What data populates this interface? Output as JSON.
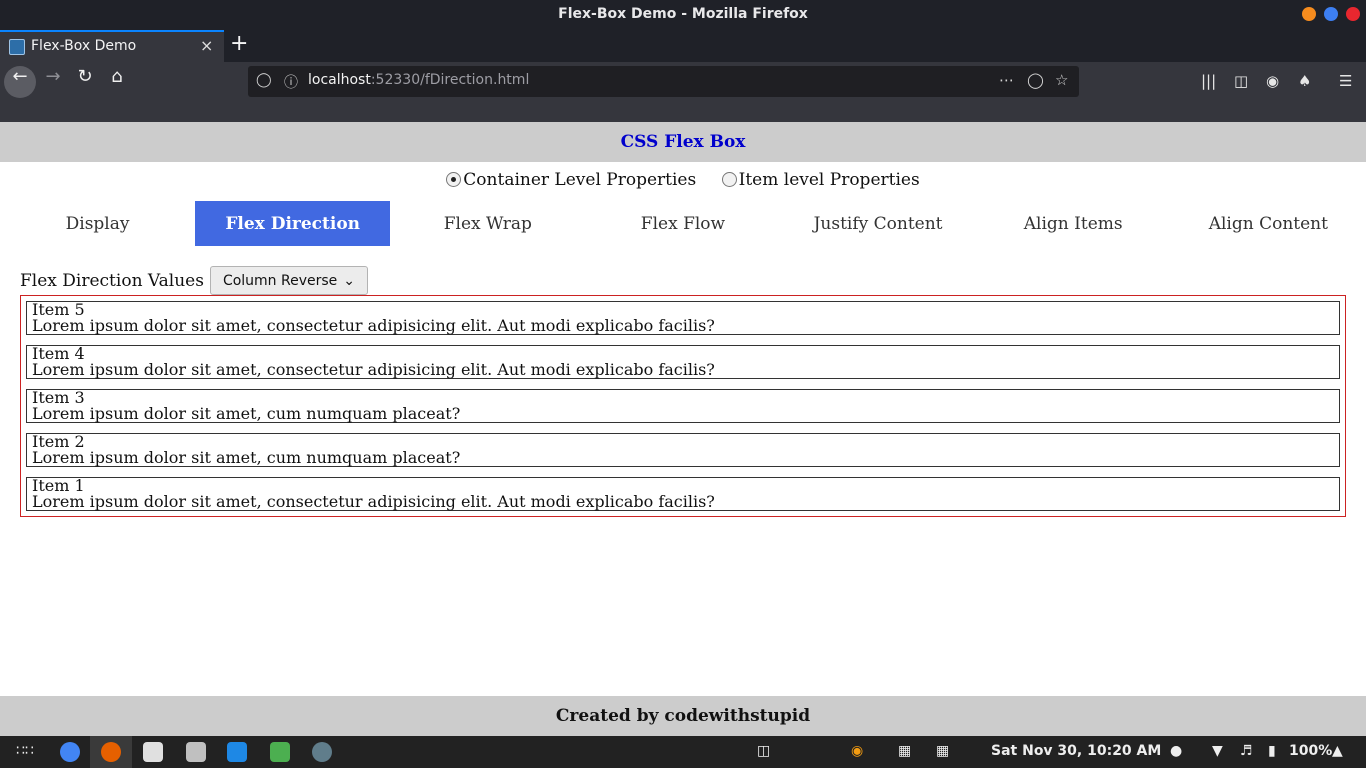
{
  "window": {
    "title": "Flex-Box Demo - Mozilla Firefox"
  },
  "browser": {
    "tab_title": "Flex-Box Demo",
    "tab_close": "×",
    "new_tab": "+",
    "url_host": "localhost",
    "url_rest": ":52330/fDirection.html",
    "icons": [
      "back-icon",
      "forward-icon",
      "reload-icon",
      "home-icon",
      "shield-icon",
      "info-icon",
      "more-icon",
      "pocket-icon",
      "bookmark-star-icon",
      "library-icon",
      "sidebar-icon",
      "account-icon",
      "extension-icon",
      "menu-icon"
    ]
  },
  "page": {
    "header_title": "CSS Flex Box",
    "radios": [
      {
        "label": "Container Level Properties",
        "checked": true
      },
      {
        "label": "Item level Properties",
        "checked": false
      }
    ],
    "tabs": [
      {
        "label": "Display"
      },
      {
        "label": "Flex Direction"
      },
      {
        "label": "Flex Wrap"
      },
      {
        "label": "Flex Flow"
      },
      {
        "label": "Justify Content"
      },
      {
        "label": "Align Items"
      },
      {
        "label": "Align Content"
      }
    ],
    "active_tab": "Flex Direction",
    "controls": {
      "label": "Flex Direction Values",
      "selected": "Column Reverse"
    },
    "items": [
      {
        "title": "Item 5",
        "text": "Lorem ipsum dolor sit amet, consectetur adipisicing elit. Aut modi explicabo facilis?"
      },
      {
        "title": "Item 4",
        "text": "Lorem ipsum dolor sit amet, consectetur adipisicing elit. Aut modi explicabo facilis?"
      },
      {
        "title": "Item 3",
        "text": "Lorem ipsum dolor sit amet, cum numquam placeat?"
      },
      {
        "title": "Item 2",
        "text": "Lorem ipsum dolor sit amet, cum numquam placeat?"
      },
      {
        "title": "Item 1",
        "text": "Lorem ipsum dolor sit amet, consectetur adipisicing elit. Aut modi explicabo facilis?"
      }
    ],
    "footer": "Created by codewithstupid"
  },
  "taskbar": {
    "clock": "Sat Nov 30, 10:20 AM",
    "battery": "100%"
  },
  "colors": {
    "active_tab_bg": "#4169e1",
    "header_title": "#0000cc",
    "container_border": "#cc2222",
    "header_bg": "#cccccc"
  }
}
